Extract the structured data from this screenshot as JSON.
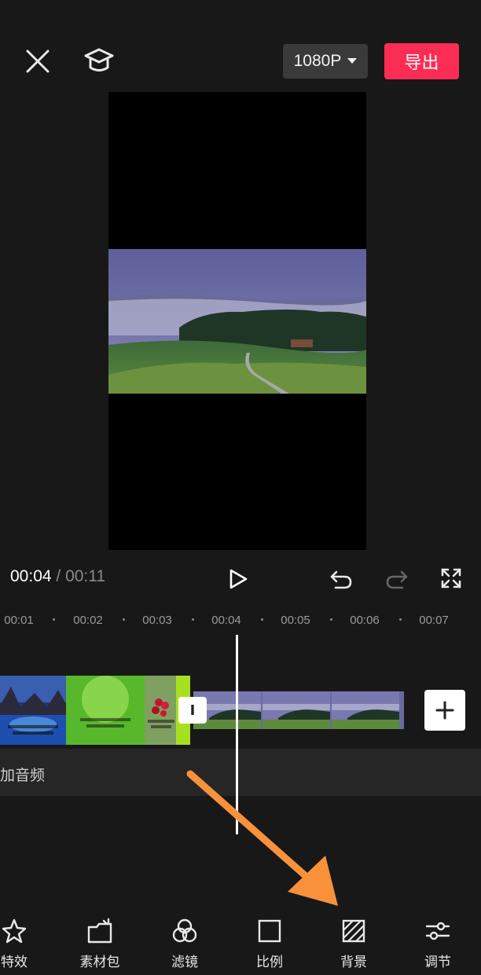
{
  "header": {
    "resolution_label": "1080P",
    "export_label": "导出"
  },
  "playback": {
    "current_time": "00:04",
    "separator": " / ",
    "total_time": "00:11"
  },
  "ruler": {
    "ticks": [
      "00:01",
      "00:02",
      "00:03",
      "00:04",
      "00:05",
      "00:06",
      "00:07"
    ]
  },
  "timeline": {
    "audio_label": "加音频",
    "transition_symbol": "I"
  },
  "toolbar": {
    "items": [
      {
        "label": "特效",
        "icon": "star-effects-icon"
      },
      {
        "label": "素材包",
        "icon": "material-pack-icon"
      },
      {
        "label": "滤镜",
        "icon": "filter-icon"
      },
      {
        "label": "比例",
        "icon": "ratio-icon"
      },
      {
        "label": "背景",
        "icon": "background-icon"
      },
      {
        "label": "调节",
        "icon": "adjust-icon"
      }
    ]
  },
  "colors": {
    "background": "#181818",
    "export_accent": "#fb2d55",
    "annotation_arrow": "#f7923a"
  }
}
